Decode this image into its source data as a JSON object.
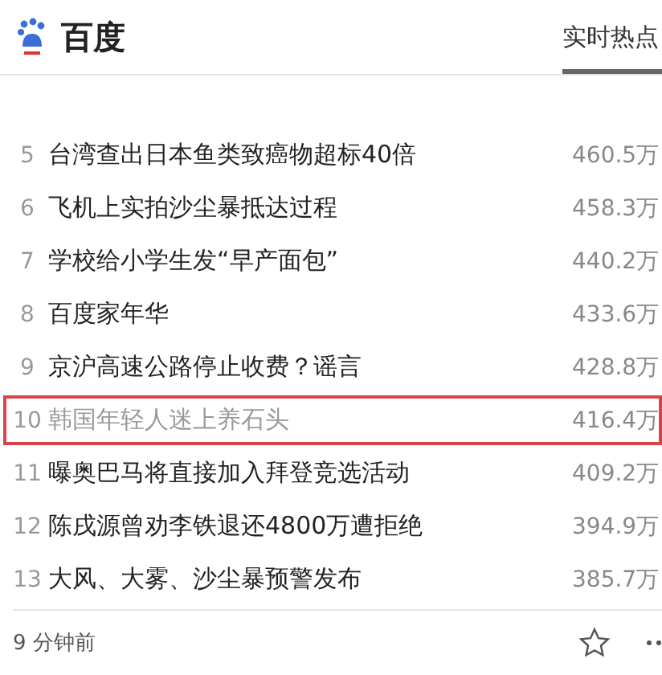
{
  "header": {
    "title": "百度",
    "tab": {
      "label": "实时热点",
      "selected": true
    }
  },
  "rows": [
    {
      "rank": "5",
      "title": "台湾查出日本鱼类致癌物超标40倍",
      "heat": "460.5万",
      "selected": false
    },
    {
      "rank": "6",
      "title": "飞机上实拍沙尘暴抵达过程",
      "heat": "458.3万",
      "selected": false
    },
    {
      "rank": "7",
      "title": "学校给小学生发“早产面包”",
      "heat": "440.2万",
      "selected": false
    },
    {
      "rank": "8",
      "title": "百度家年华",
      "heat": "433.6万",
      "selected": false
    },
    {
      "rank": "9",
      "title": "京沪高速公路停止收费？谣言",
      "heat": "428.8万",
      "selected": false
    },
    {
      "rank": "10",
      "title": "韩国年轻人迷上养石头",
      "heat": "416.4万",
      "selected": true
    },
    {
      "rank": "11",
      "title": "曝奥巴马将直接加入拜登竞选活动",
      "heat": "409.2万",
      "selected": false
    },
    {
      "rank": "12",
      "title": "陈戌源曾劝李铁退还4800万遭拒绝",
      "heat": "394.9万",
      "selected": false
    },
    {
      "rank": "13",
      "title": "大风、大雾、沙尘暴预警发布",
      "heat": "385.7万",
      "selected": false
    }
  ],
  "footer": {
    "time": "9 分钟前"
  }
}
